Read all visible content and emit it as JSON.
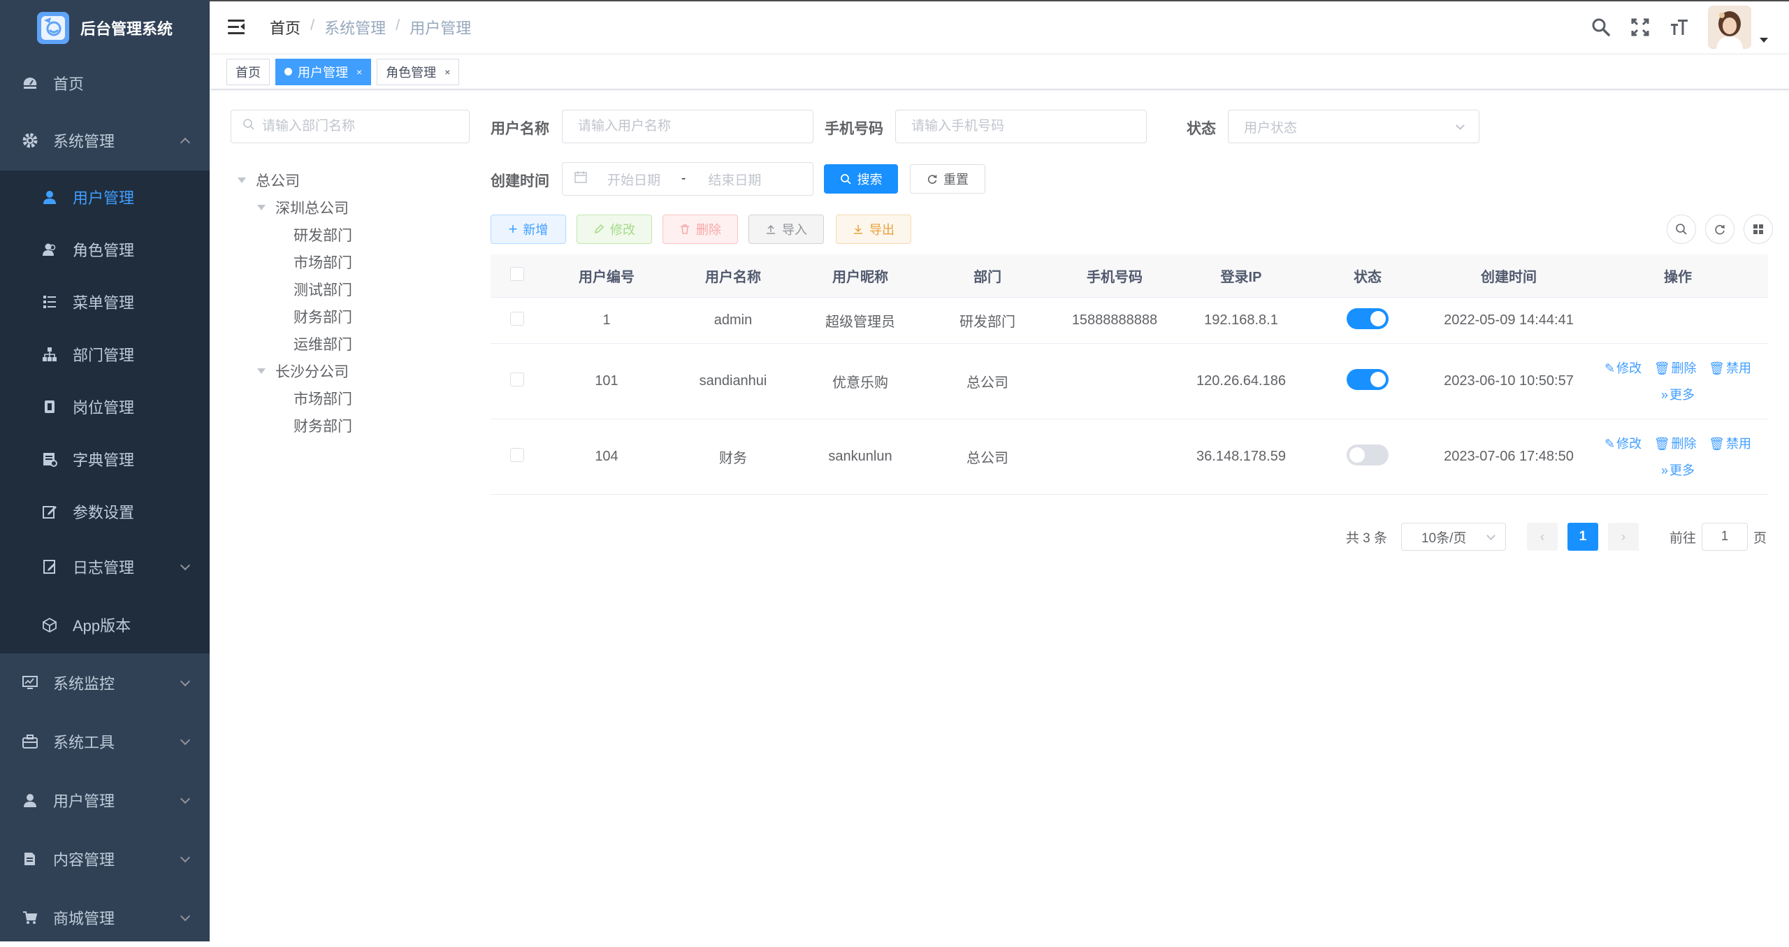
{
  "app": {
    "title": "后台管理系统"
  },
  "sidebar": {
    "items": [
      {
        "label": "首页",
        "icon": "dashboard-icon"
      },
      {
        "label": "系统管理",
        "icon": "gear-icon",
        "expanded": true,
        "children": [
          {
            "label": "用户管理",
            "icon": "user-icon",
            "active": true
          },
          {
            "label": "角色管理",
            "icon": "peoples-icon"
          },
          {
            "label": "菜单管理",
            "icon": "tree-table-icon"
          },
          {
            "label": "部门管理",
            "icon": "org-tree-icon"
          },
          {
            "label": "岗位管理",
            "icon": "post-icon"
          },
          {
            "label": "字典管理",
            "icon": "dict-icon"
          },
          {
            "label": "参数设置",
            "icon": "edit-icon"
          },
          {
            "label": "日志管理",
            "icon": "log-icon"
          },
          {
            "label": "App版本",
            "icon": "cube-icon"
          }
        ]
      },
      {
        "label": "系统监控",
        "icon": "monitor-icon"
      },
      {
        "label": "系统工具",
        "icon": "tool-icon"
      },
      {
        "label": "用户管理",
        "icon": "user-icon"
      },
      {
        "label": "内容管理",
        "icon": "document-icon"
      },
      {
        "label": "商城管理",
        "icon": "cart-icon"
      }
    ]
  },
  "breadcrumb": [
    "首页",
    "系统管理",
    "用户管理"
  ],
  "tags": [
    {
      "label": "首页",
      "active": false
    },
    {
      "label": "用户管理",
      "active": true
    },
    {
      "label": "角色管理",
      "active": false
    }
  ],
  "dept_tree": {
    "search_placeholder": "请输入部门名称",
    "nodes": [
      {
        "label": "总公司",
        "level": 0,
        "expanded": true
      },
      {
        "label": "深圳总公司",
        "level": 1,
        "expanded": true
      },
      {
        "label": "研发部门",
        "level": 2
      },
      {
        "label": "市场部门",
        "level": 2
      },
      {
        "label": "测试部门",
        "level": 2
      },
      {
        "label": "财务部门",
        "level": 2
      },
      {
        "label": "运维部门",
        "level": 2
      },
      {
        "label": "长沙分公司",
        "level": 1,
        "expanded": true
      },
      {
        "label": "市场部门",
        "level": 2
      },
      {
        "label": "财务部门",
        "level": 2
      }
    ]
  },
  "search_form": {
    "username_label": "用户名称",
    "username_placeholder": "请输入用户名称",
    "phone_label": "手机号码",
    "phone_placeholder": "请输入手机号码",
    "status_label": "状态",
    "status_placeholder": "用户状态",
    "created_label": "创建时间",
    "start_placeholder": "开始日期",
    "range_sep": "-",
    "end_placeholder": "结束日期",
    "search_btn": "搜索",
    "reset_btn": "重置"
  },
  "toolbar": {
    "add": "新增",
    "edit": "修改",
    "delete": "删除",
    "import": "导入",
    "export": "导出"
  },
  "table": {
    "columns": [
      "用户编号",
      "用户名称",
      "用户昵称",
      "部门",
      "手机号码",
      "登录IP",
      "状态",
      "创建时间",
      "操作"
    ],
    "rows": [
      {
        "id": "1",
        "username": "admin",
        "nickname": "超级管理员",
        "dept": "研发部门",
        "phone": "15888888888",
        "ip": "192.168.8.1",
        "status_on": true,
        "created": "2022-05-09 14:44:41",
        "has_ops": false
      },
      {
        "id": "101",
        "username": "sandianhui",
        "nickname": "优意乐购",
        "dept": "总公司",
        "phone": "",
        "ip": "120.26.64.186",
        "status_on": true,
        "created": "2023-06-10 10:50:57",
        "has_ops": true
      },
      {
        "id": "104",
        "username": "财务",
        "nickname": "sankunlun",
        "dept": "总公司",
        "phone": "",
        "ip": "36.148.178.59",
        "status_on": false,
        "created": "2023-07-06 17:48:50",
        "has_ops": true
      }
    ],
    "ops": {
      "edit": "修改",
      "delete": "删除",
      "disable": "禁用",
      "more": "更多"
    }
  },
  "pagination": {
    "total_text": "共 3 条",
    "page_size": "10条/页",
    "current_page": "1",
    "goto_label": "前往",
    "goto_value": "1",
    "page_unit": "页"
  },
  "colors": {
    "sidebar_bg": "#304156",
    "submenu_bg": "#1f2d3d",
    "primary": "#1890ff",
    "menu_text": "#bfcbd9"
  }
}
